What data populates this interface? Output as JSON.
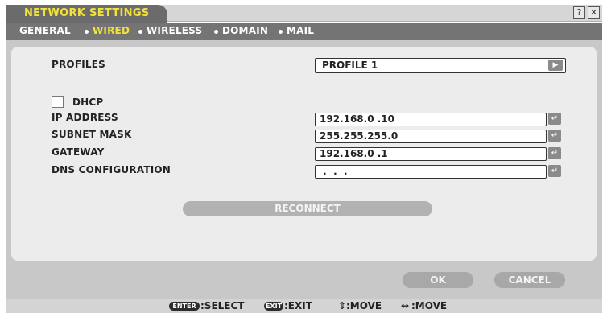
{
  "window": {
    "title": "NETWORK SETTINGS",
    "help_label": "?",
    "close_label": "✕"
  },
  "tabs": [
    {
      "label": "GENERAL",
      "selected": false
    },
    {
      "label": "WIRED",
      "selected": true
    },
    {
      "label": "WIRELESS",
      "selected": false
    },
    {
      "label": "DOMAIN",
      "selected": false
    },
    {
      "label": "MAIL",
      "selected": false
    }
  ],
  "profiles": {
    "label": "PROFILES",
    "value": "PROFILE 1",
    "arrow": "▶"
  },
  "dhcp": {
    "label": "DHCP",
    "checked": false
  },
  "fields": [
    {
      "label": "IP ADDRESS",
      "value": "192.168.0 .10"
    },
    {
      "label": "SUBNET MASK",
      "value": "255.255.255.0"
    },
    {
      "label": "GATEWAY",
      "value": "192.168.0 .1"
    },
    {
      "label": "DNS CONFIGURATION",
      "value": " .  .  ."
    }
  ],
  "enter_glyph": "↵",
  "buttons": {
    "reconnect": "RECONNECT",
    "ok": "OK",
    "cancel": "CANCEL"
  },
  "statusbar": {
    "enter_key": "ENTER",
    "select": ":SELECT",
    "exit_key": "EXIT",
    "exit": ":EXIT",
    "move_v_glyph": "⇕",
    "move_v": ":MOVE",
    "move_h_glyph": "↔",
    "move_h": ":MOVE"
  },
  "colors": {
    "accent": "#f2e23a",
    "tabbar": "#747474",
    "panel": "#ececec",
    "frame": "#c8c8c8"
  }
}
